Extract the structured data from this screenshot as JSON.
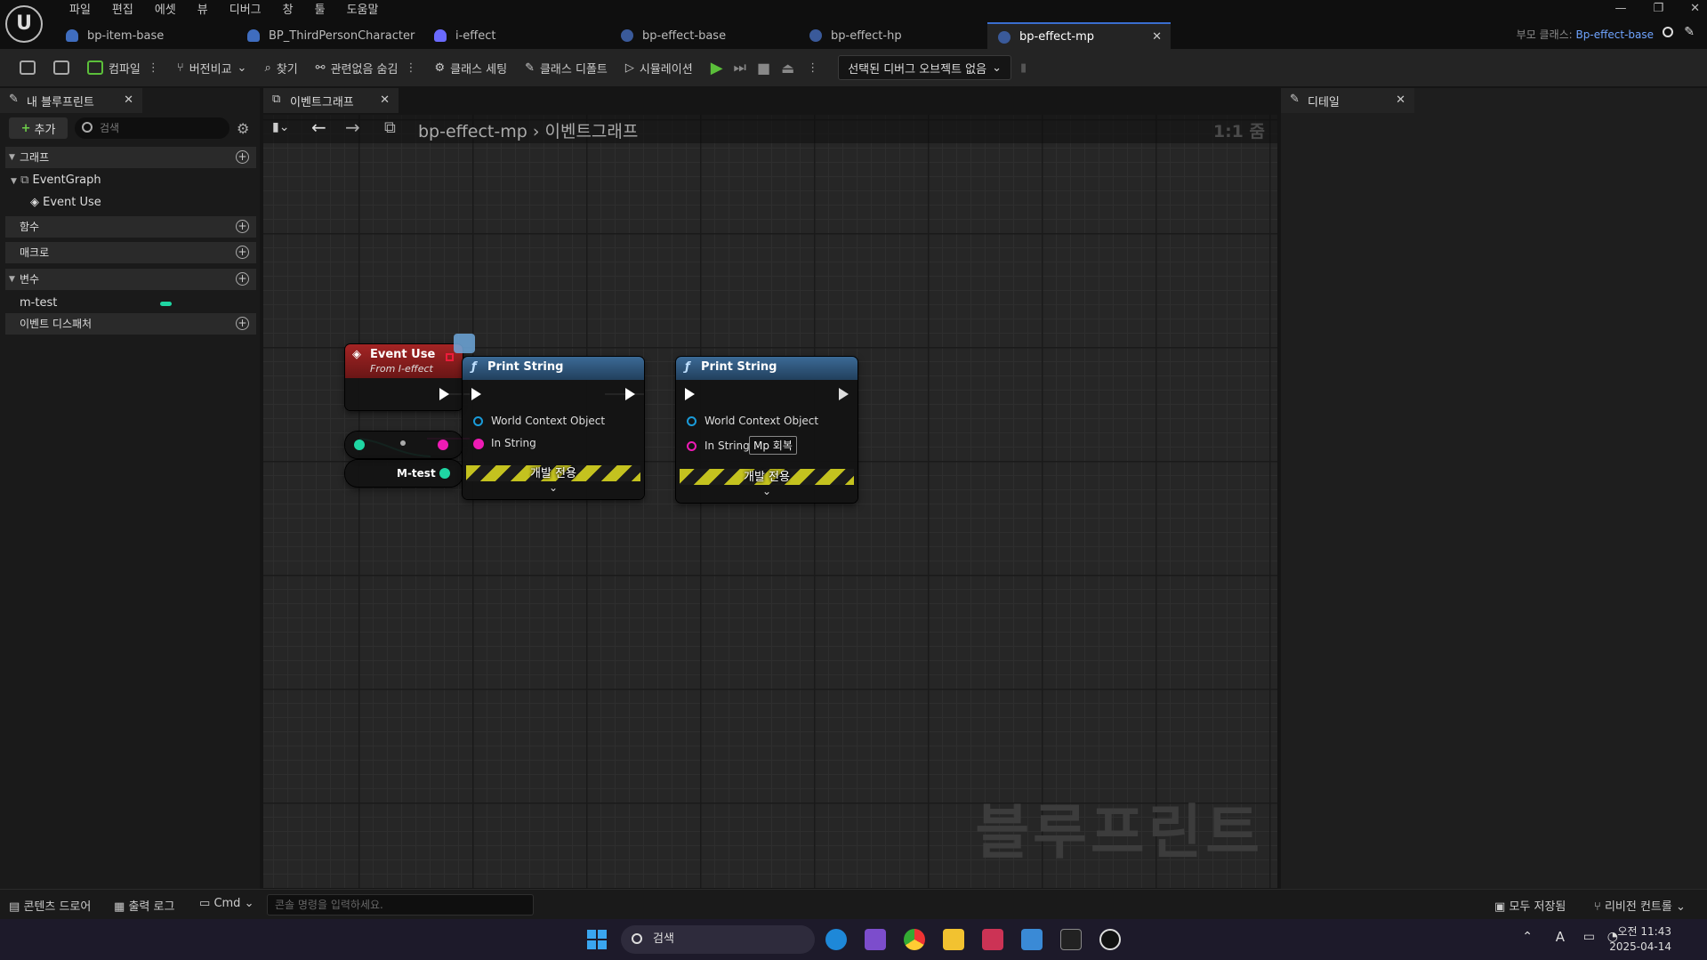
{
  "menu": [
    "파일",
    "편집",
    "에셋",
    "뷰",
    "디버그",
    "창",
    "툴",
    "도움말"
  ],
  "tabs": [
    {
      "label": "bp-item-base",
      "active": false
    },
    {
      "label": "BP_ThirdPersonCharacter",
      "active": false
    },
    {
      "label": "i-effect",
      "active": false
    },
    {
      "label": "bp-effect-base",
      "active": false
    },
    {
      "label": "bp-effect-hp",
      "active": false
    },
    {
      "label": "bp-effect-mp",
      "active": true
    }
  ],
  "parent_class": {
    "label": "부모 클래스:",
    "value": "Bp-effect-base"
  },
  "toolbar": {
    "compile": "컴파일",
    "diff": "버전비교",
    "find": "찾기",
    "hide_unrelated": "관련없음 숨김",
    "class_settings": "클래스 세팅",
    "class_defaults": "클래스 디폴트",
    "simulation": "시뮬레이션",
    "debug_object": "선택된 디버그 오브젝트 없음"
  },
  "left_panel": {
    "tab": "내 블루프린트",
    "add": "추가",
    "search_placeholder": "검색",
    "sections": {
      "graphs": "그래프",
      "event_graph": "EventGraph",
      "event_use": "Event Use",
      "functions": "함수",
      "macros": "매크로",
      "variables": "변수",
      "variable_item": "m-test",
      "dispatchers": "이벤트 디스패처"
    }
  },
  "graph": {
    "tab": "이벤트그래프",
    "breadcrumb_bp": "bp-effect-mp",
    "breadcrumb_sep": "›",
    "breadcrumb_graph": "이벤트그래프",
    "zoom": "1:1 줌",
    "watermark": "블루프린트",
    "nodes": {
      "event": {
        "title": "Event Use",
        "subtitle": "From I-effect"
      },
      "variable": {
        "label": "M-test"
      },
      "print1": {
        "title": "Print String",
        "pin_context": "World Context Object",
        "pin_string": "In String",
        "dev": "개발 전용"
      },
      "print2": {
        "title": "Print String",
        "pin_context": "World Context Object",
        "pin_string": "In String",
        "string_value": "Mp 회복",
        "dev": "개발 전용"
      }
    }
  },
  "right_panel": {
    "tab": "디테일"
  },
  "bottom": {
    "content_drawer": "콘텐츠 드로어",
    "output_log": "출력 로그",
    "cmd": "Cmd",
    "console_placeholder": "콘솔 명령을 입력하세요.",
    "save_all": "모두 저장됨",
    "revision_control": "리비전 컨트롤"
  },
  "taskbar": {
    "search": "검색",
    "time": "오전 11:43",
    "date": "2025-04-14"
  },
  "colors": {
    "event_header": "#8f1f1f",
    "function_header": "#2b4d6e",
    "exec_pin": "#ffffff",
    "string_pin": "#ee1bb5",
    "object_pin": "#1a9bd9",
    "variable_pin": "#1fd6a3",
    "accent": "#3a6ecf"
  }
}
